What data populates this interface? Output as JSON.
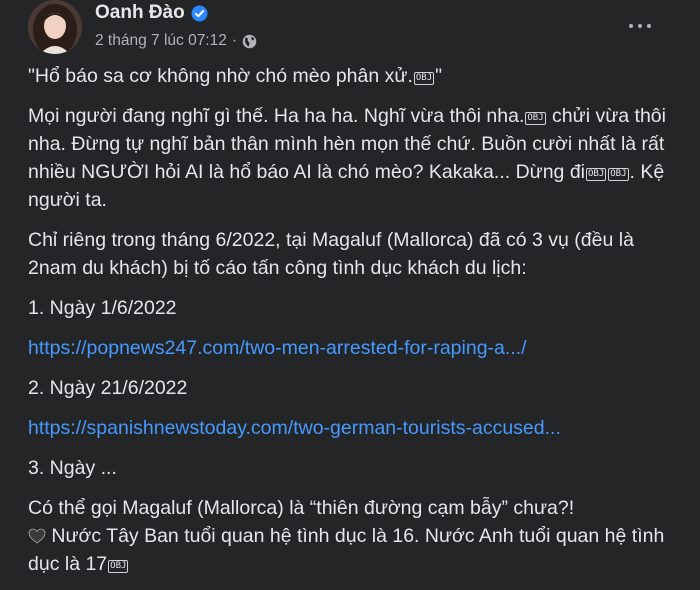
{
  "author": {
    "name": "Oanh Đào",
    "timestamp": "2 tháng 7 lúc 07:12"
  },
  "post": {
    "quote": "\"Hổ báo sa cơ không nhờ chó mèo phân xử.",
    "quote_end": "\"",
    "p2_a": "Mọi người đang nghĩ gì thế. Ha ha ha. Nghĩ vừa thôi nha.",
    "p2_b": " chửi vừa thôi nha. Đừng tự nghĩ bản thân mình hèn mọn thế chứ. Buồn cười nhất là rất nhiều NGƯỜI hỏi AI là hổ báo AI là chó mèo? Kakaka... Dừng đi",
    "p2_c": ". Kệ người ta.",
    "p3": "Chỉ riêng trong tháng 6/2022, tại Magaluf (Mallorca) đã có 3 vụ (đều là 2nam du khách) bị tố cáo tấn công tình dục khách du lịch:",
    "item1": "1. Ngày 1/6/2022",
    "link1": "https://popnews247.com/two-men-arrested-for-raping-a.../",
    "item2": "2. Ngày 21/6/2022",
    "link2": "https://spanishnewstoday.com/two-german-tourists-accused...",
    "item3": "3. Ngày ...",
    "p_last_a": "Có thể gọi Magaluf (Mallorca) là “thiên đường cạm bẫy” chưa?!",
    "p_last_b": " Nước Tây Ban tuổi quan hệ tình dục là 16. Nước Anh tuổi quan hệ tình dục là 17",
    "obj_glyph": "OBJ"
  },
  "colors": {
    "background": "#242526",
    "text": "#e4e6eb",
    "secondary": "#b0b3b8",
    "link": "#4599ff",
    "verified": "#2d88ff"
  }
}
